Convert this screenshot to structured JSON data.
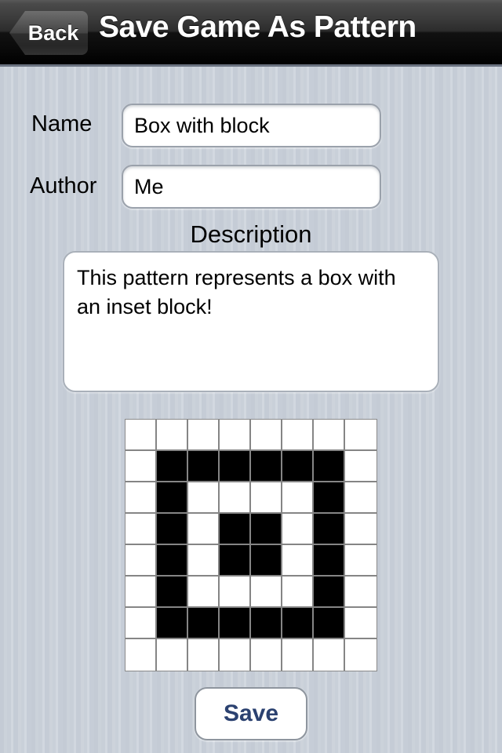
{
  "navbar": {
    "back_label": "Back",
    "title": "Save Game As Pattern"
  },
  "form": {
    "name_label": "Name",
    "name_value": "Box with block",
    "name_placeholder": "",
    "author_label": "Author",
    "author_value": "Me",
    "author_placeholder": "",
    "description_heading": "Description",
    "description_value": "This pattern represents a box with an inset block!",
    "description_placeholder": ""
  },
  "actions": {
    "save_label": "Save"
  },
  "colors": {
    "background": "#c7ced7",
    "navbar_top": "#585858",
    "navbar_bottom": "#000000",
    "cell_on": "#000000",
    "cell_off": "#ffffff",
    "grid_line": "#858585",
    "save_text": "#2b4170"
  },
  "pattern_grid": {
    "rows": 8,
    "cols": 8,
    "legend": {
      "0": "empty",
      "1": "filled"
    },
    "cells": [
      [
        0,
        0,
        0,
        0,
        0,
        0,
        0,
        0
      ],
      [
        0,
        1,
        1,
        1,
        1,
        1,
        1,
        0
      ],
      [
        0,
        1,
        0,
        0,
        0,
        0,
        1,
        0
      ],
      [
        0,
        1,
        0,
        1,
        1,
        0,
        1,
        0
      ],
      [
        0,
        1,
        0,
        1,
        1,
        0,
        1,
        0
      ],
      [
        0,
        1,
        0,
        0,
        0,
        0,
        1,
        0
      ],
      [
        0,
        1,
        1,
        1,
        1,
        1,
        1,
        0
      ],
      [
        0,
        0,
        0,
        0,
        0,
        0,
        0,
        0
      ]
    ]
  }
}
